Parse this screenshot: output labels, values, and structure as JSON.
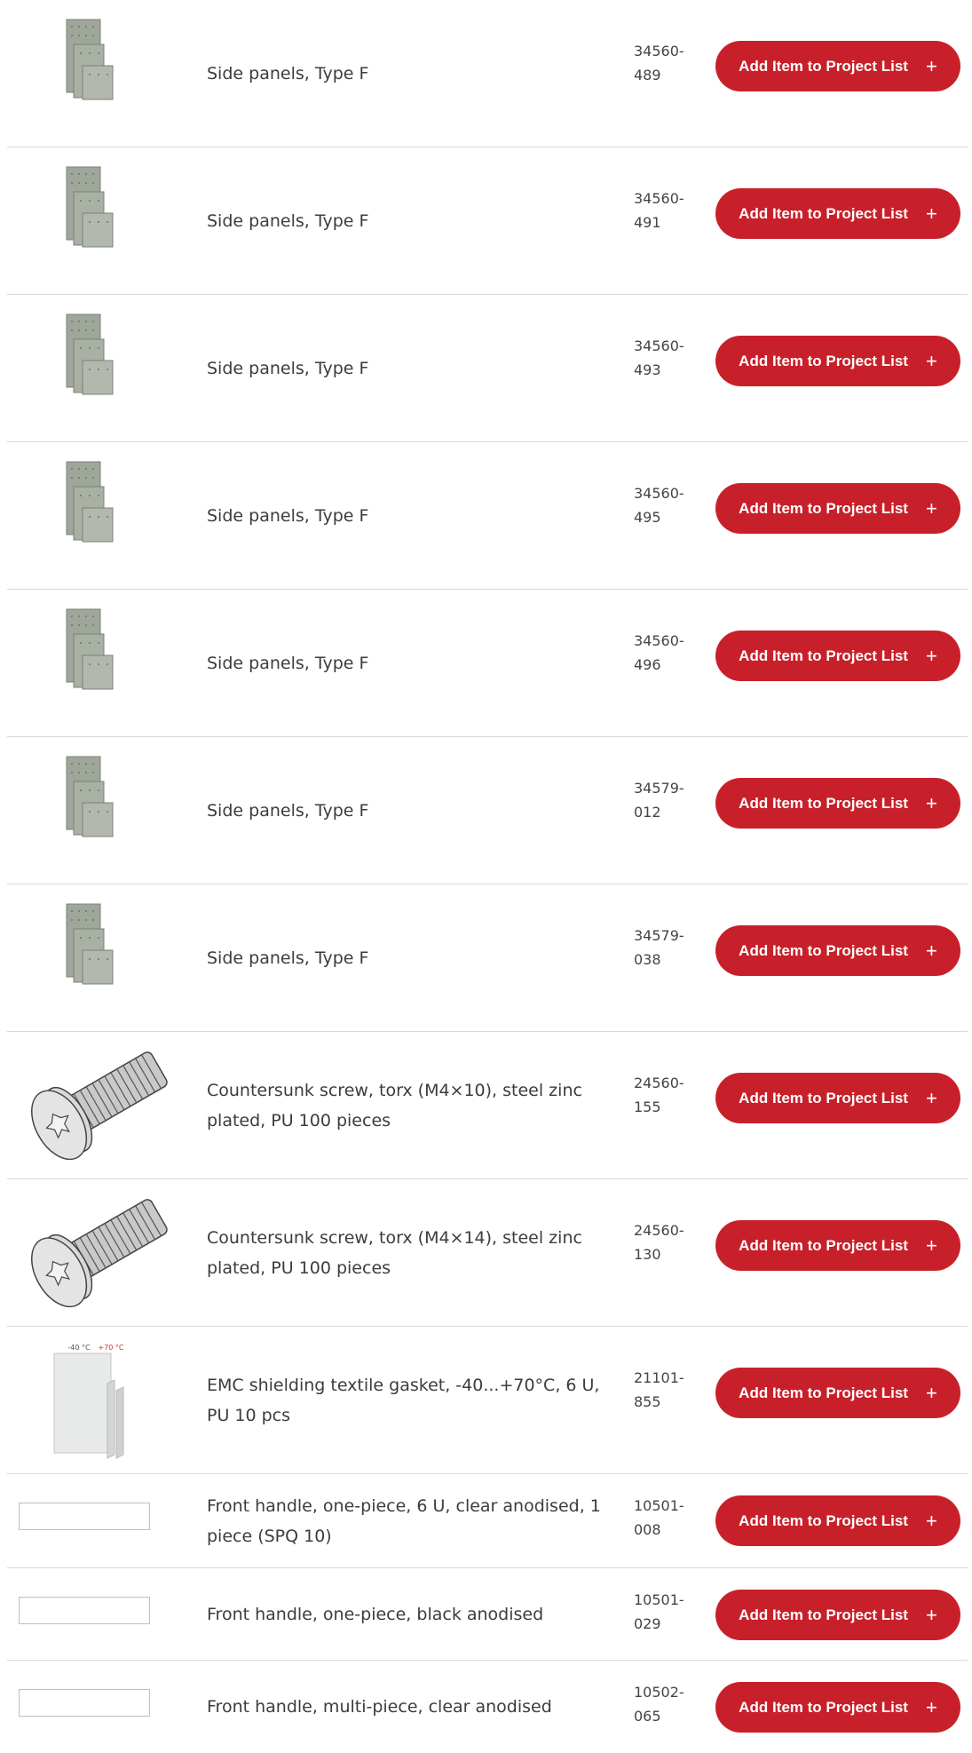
{
  "button_label": "Add Item to Project List",
  "button_icon": "plus-icon",
  "accent_color": "#c8202a",
  "items": [
    {
      "image": "side-panel",
      "description": "Side panels, Type F",
      "part_line1": "34560-",
      "part_line2": "489"
    },
    {
      "image": "side-panel",
      "description": "Side panels, Type F",
      "part_line1": "34560-",
      "part_line2": "491"
    },
    {
      "image": "side-panel",
      "description": "Side panels, Type F",
      "part_line1": "34560-",
      "part_line2": "493"
    },
    {
      "image": "side-panel",
      "description": "Side panels, Type F",
      "part_line1": "34560-",
      "part_line2": "495"
    },
    {
      "image": "side-panel",
      "description": "Side panels, Type F",
      "part_line1": "34560-",
      "part_line2": "496"
    },
    {
      "image": "side-panel",
      "description": "Side panels, Type F",
      "part_line1": "34579-",
      "part_line2": "012"
    },
    {
      "image": "side-panel",
      "description": "Side panels, Type F",
      "part_line1": "34579-",
      "part_line2": "038"
    },
    {
      "image": "screw",
      "description": "Countersunk screw, torx (M4×10), steel zinc plated, PU 100 pieces",
      "part_line1": "24560-",
      "part_line2": "155"
    },
    {
      "image": "screw",
      "description": "Countersunk screw, torx (M4×14), steel zinc plated, PU 100 pieces",
      "part_line1": "24560-",
      "part_line2": "130"
    },
    {
      "image": "gasket",
      "image_labels": [
        "-40 °C",
        "+70 °C"
      ],
      "description": "EMC shielding textile gasket, -40...+70°C, 6 U, PU 10 pcs",
      "part_line1": "21101-",
      "part_line2": "855"
    },
    {
      "image": "placeholder",
      "description": "Front handle, one-piece, 6 U, clear anodised, 1 piece (SPQ 10)",
      "part_line1": "10501-",
      "part_line2": "008"
    },
    {
      "image": "placeholder",
      "description": "Front handle, one-piece, black anodised",
      "part_line1": "10501-",
      "part_line2": "029"
    },
    {
      "image": "placeholder",
      "description": "Front handle, multi-piece, clear anodised",
      "part_line1": "10502-",
      "part_line2": "065"
    }
  ]
}
